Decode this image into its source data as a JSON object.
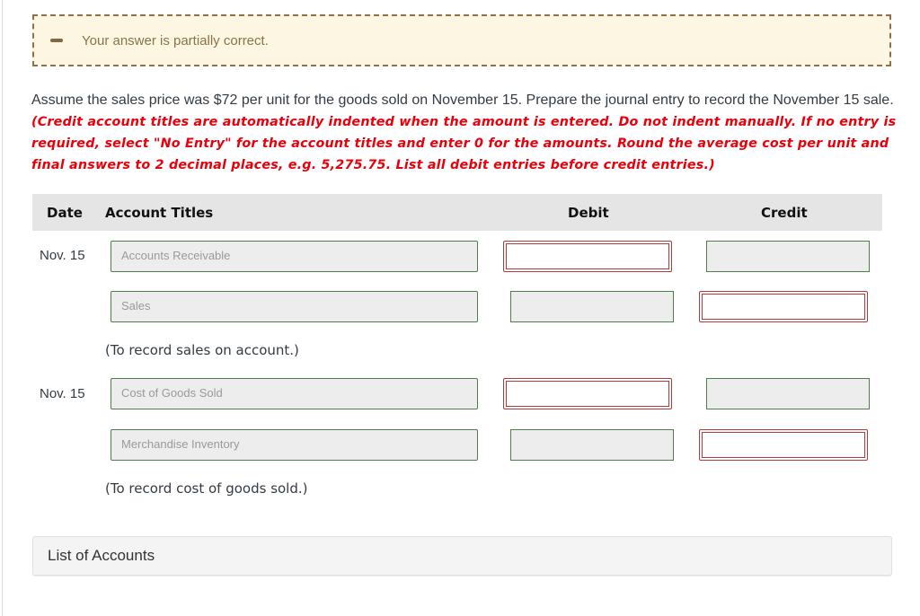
{
  "status": {
    "icon": "minus-partial-icon",
    "text": "Your answer is partially correct."
  },
  "question": {
    "text": "Assume the sales price was $72 per unit for the goods sold on November 15. Prepare the journal entry to record the November 15 sale.",
    "instructions": "(Credit account titles are automatically indented when the amount is entered. Do not indent manually. If no entry is required, select \"No Entry\" for the account titles and enter 0 for the amounts. Round the average cost per unit and final answers to 2 decimal places, e.g. 5,275.75. List all debit entries before credit entries.)"
  },
  "table": {
    "headers": {
      "date": "Date",
      "account": "Account Titles",
      "debit": "Debit",
      "credit": "Credit"
    },
    "entries": [
      {
        "date": "Nov. 15",
        "lines": [
          {
            "account": "Accounts Receivable",
            "debit": "",
            "debit_status": "incorrect",
            "credit": "",
            "credit_status": "correct"
          },
          {
            "account": "Sales",
            "debit": "",
            "debit_status": "correct",
            "credit": "",
            "credit_status": "incorrect"
          }
        ],
        "memo": "(To record sales on account.)"
      },
      {
        "date": "Nov. 15",
        "lines": [
          {
            "account": "Cost of Goods Sold",
            "debit": "",
            "debit_status": "incorrect",
            "credit": "",
            "credit_status": "correct"
          },
          {
            "account": "Merchandise Inventory",
            "debit": "",
            "debit_status": "correct",
            "credit": "",
            "credit_status": "incorrect"
          }
        ],
        "memo": "(To record cost of goods sold.)"
      }
    ]
  },
  "list_of_accounts": {
    "label": "List of Accounts"
  },
  "colors": {
    "correct_border": "#4e7f4a",
    "incorrect_border": "#b33b3b",
    "instruction_red": "#e8000b",
    "status_bg": "#fcf6e3",
    "status_border": "#8a7349"
  }
}
